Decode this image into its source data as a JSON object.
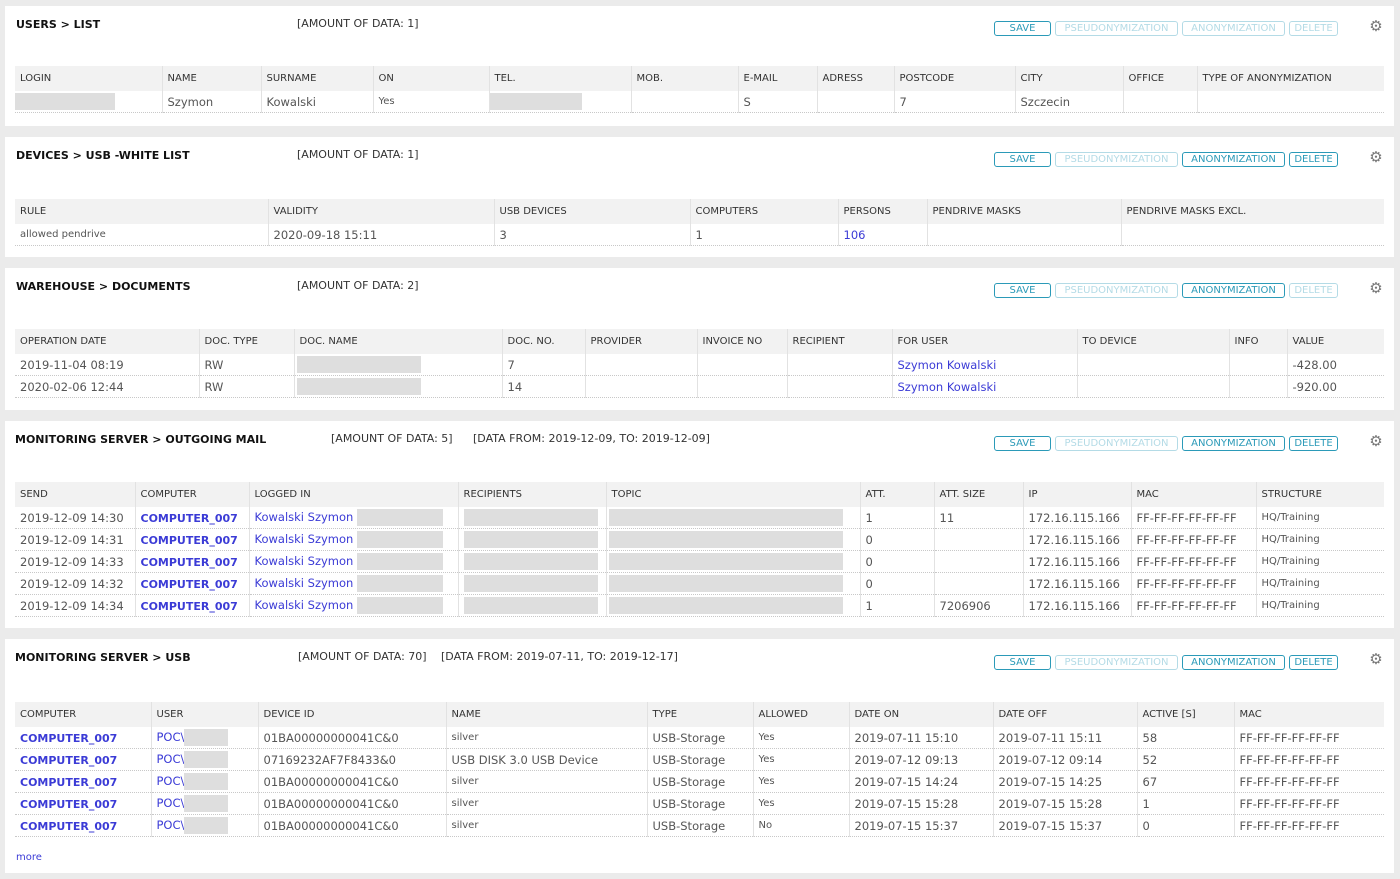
{
  "buttons": {
    "save": "SAVE",
    "pseudonymization": "PSEUDONYMIZATION",
    "anonymization": "ANONYMIZATION",
    "delete": "DELETE"
  },
  "users": {
    "title": "USERS > LIST",
    "amount": "[AMOUNT OF DATA: 1]",
    "columns": [
      "LOGIN",
      "NAME",
      "SURNAME",
      "ON",
      "TEL.",
      "MOB.",
      "E-MAIL",
      "ADRESS",
      "POSTCODE",
      "CITY",
      "OFFICE",
      "TYPE OF ANONYMIZATION"
    ],
    "rows": [
      {
        "login": "",
        "name": "Szymon",
        "surname": "Kowalski",
        "on": "Yes",
        "tel": "",
        "mob": "",
        "email": "S",
        "adress": "",
        "postcode": "7",
        "city": "Szczecin",
        "office": "",
        "type": ""
      }
    ]
  },
  "usb_white": {
    "title": "DEVICES > USB -WHITE LIST",
    "amount": "[AMOUNT OF DATA: 1]",
    "columns": [
      "RULE",
      "VALIDITY",
      "USB DEVICES",
      "COMPUTERS",
      "PERSONS",
      "PENDRIVE MASKS",
      "PENDRIVE MASKS EXCL."
    ],
    "rows": [
      {
        "rule": "allowed pendrive",
        "validity": "2020-09-18 15:11",
        "usb": "3",
        "computers": "1",
        "persons": "106",
        "masks": "",
        "masks_excl": ""
      }
    ]
  },
  "warehouse": {
    "title": "WAREHOUSE > DOCUMENTS",
    "amount": "[AMOUNT OF DATA: 2]",
    "columns": [
      "OPERATION DATE",
      "DOC. TYPE",
      "DOC. NAME",
      "DOC. NO.",
      "PROVIDER",
      "INVOICE NO",
      "RECIPIENT",
      "FOR USER",
      "TO DEVICE",
      "INFO",
      "VALUE"
    ],
    "rows": [
      {
        "date": "2019-11-04 08:19",
        "type": "RW",
        "name": "",
        "no": "7",
        "provider": "",
        "invoice": "",
        "recipient": "",
        "for_user": "Szymon Kowalski",
        "to_device": "",
        "info": "",
        "value": "-428.00"
      },
      {
        "date": "2020-02-06 12:44",
        "type": "RW",
        "name": "",
        "no": "14",
        "provider": "",
        "invoice": "",
        "recipient": "",
        "for_user": "Szymon Kowalski",
        "to_device": "",
        "info": "",
        "value": "-920.00"
      }
    ]
  },
  "mail": {
    "title": "MONITORING SERVER > OUTGOING MAIL",
    "amount": "[AMOUNT OF DATA: 5]",
    "range": "[DATA FROM: 2019-12-09, TO: 2019-12-09]",
    "columns": [
      "SEND",
      "COMPUTER",
      "LOGGED IN",
      "RECIPIENTS",
      "TOPIC",
      "ATT.",
      "ATT. SIZE",
      "IP",
      "MAC",
      "STRUCTURE"
    ],
    "rows": [
      {
        "send": "2019-12-09 14:30",
        "computer": "COMPUTER_007",
        "logged": "Kowalski Szymon",
        "att": "1",
        "att_size": "11",
        "ip": "172.16.115.166",
        "mac": "FF-FF-FF-FF-FF-FF",
        "structure": "HQ/Training"
      },
      {
        "send": "2019-12-09 14:31",
        "computer": "COMPUTER_007",
        "logged": "Kowalski Szymon",
        "att": "0",
        "att_size": "",
        "ip": "172.16.115.166",
        "mac": "FF-FF-FF-FF-FF-FF",
        "structure": "HQ/Training"
      },
      {
        "send": "2019-12-09 14:33",
        "computer": "COMPUTER_007",
        "logged": "Kowalski Szymon",
        "att": "0",
        "att_size": "",
        "ip": "172.16.115.166",
        "mac": "FF-FF-FF-FF-FF-FF",
        "structure": "HQ/Training"
      },
      {
        "send": "2019-12-09 14:32",
        "computer": "COMPUTER_007",
        "logged": "Kowalski Szymon",
        "att": "0",
        "att_size": "",
        "ip": "172.16.115.166",
        "mac": "FF-FF-FF-FF-FF-FF",
        "structure": "HQ/Training"
      },
      {
        "send": "2019-12-09 14:34",
        "computer": "COMPUTER_007",
        "logged": "Kowalski Szymon",
        "att": "1",
        "att_size": "7206906",
        "ip": "172.16.115.166",
        "mac": "FF-FF-FF-FF-FF-FF",
        "structure": "HQ/Training"
      }
    ]
  },
  "usb": {
    "title": "MONITORING SERVER > USB",
    "amount": "[AMOUNT OF DATA: 70]",
    "range": "[DATA FROM: 2019-07-11, TO: 2019-12-17]",
    "columns": [
      "COMPUTER",
      "USER",
      "DEVICE ID",
      "NAME",
      "TYPE",
      "ALLOWED",
      "DATE ON",
      "DATE OFF",
      "ACTIVE [S]",
      "MAC"
    ],
    "rows": [
      {
        "computer": "COMPUTER_007",
        "user": "POC\\",
        "device": "01BA00000000041C&0",
        "name": "silver",
        "type": "USB-Storage",
        "allowed": "Yes",
        "on": "2019-07-11 15:10",
        "off": "2019-07-11 15:11",
        "active": "58",
        "mac": "FF-FF-FF-FF-FF-FF"
      },
      {
        "computer": "COMPUTER_007",
        "user": "POC\\",
        "device": "07169232AF7F8433&0",
        "name": "USB DISK 3.0 USB Device",
        "type": "USB-Storage",
        "allowed": "Yes",
        "on": "2019-07-12 09:13",
        "off": "2019-07-12 09:14",
        "active": "52",
        "mac": "FF-FF-FF-FF-FF-FF"
      },
      {
        "computer": "COMPUTER_007",
        "user": "POC\\",
        "device": "01BA00000000041C&0",
        "name": "silver",
        "type": "USB-Storage",
        "allowed": "Yes",
        "on": "2019-07-15 14:24",
        "off": "2019-07-15 14:25",
        "active": "67",
        "mac": "FF-FF-FF-FF-FF-FF"
      },
      {
        "computer": "COMPUTER_007",
        "user": "POC\\",
        "device": "01BA00000000041C&0",
        "name": "silver",
        "type": "USB-Storage",
        "allowed": "Yes",
        "on": "2019-07-15 15:28",
        "off": "2019-07-15 15:28",
        "active": "1",
        "mac": "FF-FF-FF-FF-FF-FF"
      },
      {
        "computer": "COMPUTER_007",
        "user": "POC\\",
        "device": "01BA00000000041C&0",
        "name": "silver",
        "type": "USB-Storage",
        "allowed": "No",
        "on": "2019-07-15 15:37",
        "off": "2019-07-15 15:37",
        "active": "0",
        "mac": "FF-FF-FF-FF-FF-FF"
      }
    ],
    "more": "more"
  }
}
